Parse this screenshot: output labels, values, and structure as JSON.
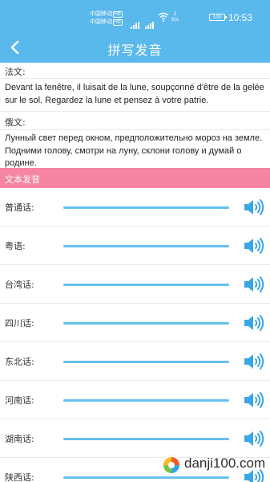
{
  "status_bar": {
    "carrier_1": "中国移动",
    "carrier_2": "中国移动",
    "hd": "HD",
    "net_speed_value": "2",
    "net_speed_unit": "K/s",
    "battery": "100",
    "time": "10:53"
  },
  "header": {
    "title": "拼写发音",
    "back_icon": "chevron-left-icon"
  },
  "french": {
    "label": "法文:",
    "text": "Devant la fenêtre, il luisait de la lune, soupçonné d'être de la gelée sur le sol. Regardez la lune et pensez à votre patrie."
  },
  "russian": {
    "label": "俄文:",
    "text": "Лунный свет перед окном, предположительно мороз на земле. Подними голову, смотри на луну, склони голову и думай о родине."
  },
  "pronunciation": {
    "section_title": "文本发音",
    "speaker_icon": "speaker-icon",
    "rows": [
      {
        "label": "普通话:"
      },
      {
        "label": "粤语:"
      },
      {
        "label": "台湾话:"
      },
      {
        "label": "四川话:"
      },
      {
        "label": "东北话:"
      },
      {
        "label": "河南话:"
      },
      {
        "label": "湖南话:"
      },
      {
        "label": "陕西话:"
      }
    ]
  },
  "watermark": {
    "text": "danji100.com"
  },
  "colors": {
    "header_blue": "#59b8ec",
    "section_pink": "#f585a2",
    "track_blue": "#66c1ed",
    "speaker_blue": "#3aa6e6"
  }
}
